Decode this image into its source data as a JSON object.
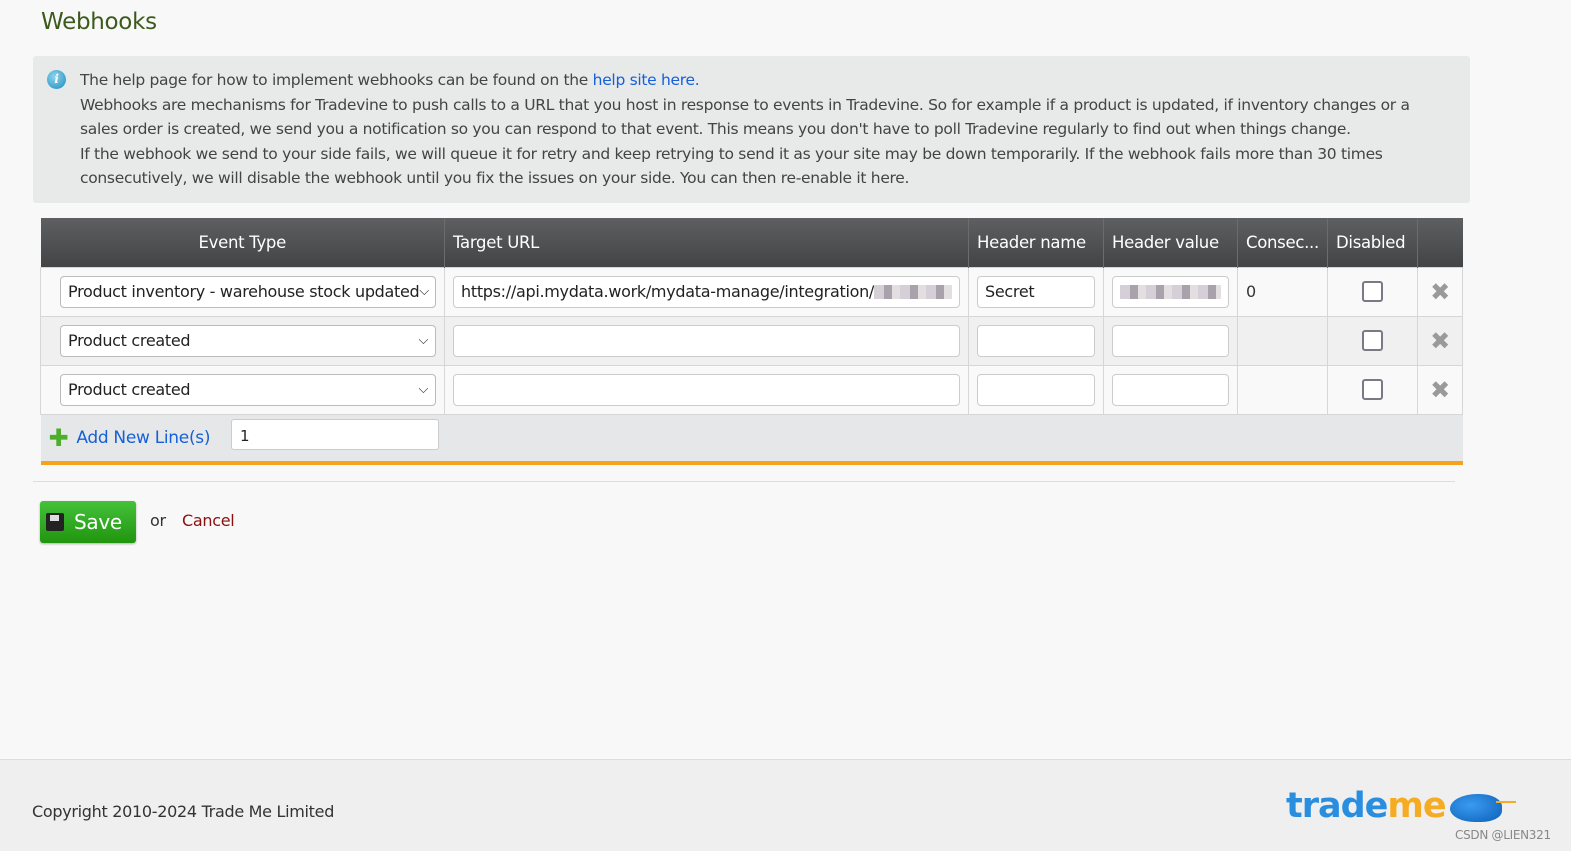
{
  "page": {
    "title": "Webhooks"
  },
  "info": {
    "line1_prefix": "The help page for how to implement webhooks can be found on the ",
    "link": "help site here.",
    "para1": "Webhooks are mechanisms for Tradevine to push calls to a URL that you host in response to events in Tradevine. So for example if a product is updated, if inventory changes or a sales order is created, we send you a notification so you can respond to that event. This means you don't have to poll Tradevine regularly to find out when things change.",
    "para2": "If the webhook we send to your side fails, we will queue it for retry and keep retrying to send it as your site may be down temporarily. If the webhook fails more than 30 times consecutively, we will disable the webhook until you fix the issues on your side. You can then re-enable it here."
  },
  "table": {
    "headers": [
      "Event Type",
      "Target URL",
      "Header name",
      "Header value",
      "Consec...",
      "Disabled"
    ],
    "rows": [
      {
        "event_type": "Product inventory - warehouse stock updated",
        "target_url": "https://api.mydata.work/mydata-manage/integration/",
        "header_name": "Secret",
        "header_value": "",
        "consecutive": "0",
        "disabled": false
      },
      {
        "event_type": "Product created",
        "target_url": "",
        "header_name": "",
        "header_value": "",
        "consecutive": "",
        "disabled": false
      },
      {
        "event_type": "Product created",
        "target_url": "",
        "header_name": "",
        "header_value": "",
        "consecutive": "",
        "disabled": false
      }
    ],
    "add_label": "Add New Line(s)",
    "add_count": "1"
  },
  "actions": {
    "save": "Save",
    "or": "or",
    "cancel": "Cancel"
  },
  "footer": {
    "copyright": "Copyright 2010-2024 Trade Me Limited",
    "logo_trade": "trade",
    "logo_me": "me",
    "watermark": "CSDN @LIEN321"
  }
}
